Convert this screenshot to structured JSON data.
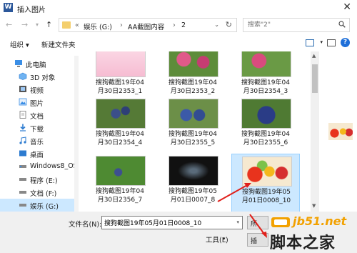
{
  "window": {
    "title": "插入图片",
    "app_icon_letter": "W"
  },
  "address": {
    "crumb_prefix": "«",
    "crumbs": [
      "娱乐 (G:)",
      "AA截图内容",
      "2"
    ],
    "separator": "›"
  },
  "search": {
    "placeholder": "搜索\"2\""
  },
  "toolbar": {
    "organize": "组织 ▾",
    "new_folder": "新建文件夹"
  },
  "sidebar": {
    "items": [
      {
        "label": "此电脑",
        "icon": "computer-icon"
      },
      {
        "label": "3D 对象",
        "icon": "cube-icon"
      },
      {
        "label": "视频",
        "icon": "video-icon"
      },
      {
        "label": "图片",
        "icon": "picture-icon"
      },
      {
        "label": "文档",
        "icon": "document-icon"
      },
      {
        "label": "下载",
        "icon": "download-icon"
      },
      {
        "label": "音乐",
        "icon": "music-icon"
      },
      {
        "label": "桌面",
        "icon": "desktop-icon"
      },
      {
        "label": "Windows8_OS",
        "icon": "drive-icon"
      },
      {
        "label": "程序 (E:)",
        "icon": "drive-icon"
      },
      {
        "label": "文档 (F:)",
        "icon": "drive-icon"
      },
      {
        "label": "娱乐 (G:)",
        "icon": "drive-icon"
      }
    ]
  },
  "files": [
    {
      "line1": "搜狗截图19年04",
      "line2": "月30日2353_1"
    },
    {
      "line1": "搜狗截图19年04",
      "line2": "月30日2353_2"
    },
    {
      "line1": "搜狗截图19年04",
      "line2": "月30日2354_3"
    },
    {
      "line1": "搜狗截图19年04",
      "line2": "月30日2354_4"
    },
    {
      "line1": "搜狗截图19年04",
      "line2": "月30日2355_5"
    },
    {
      "line1": "搜狗截图19年04",
      "line2": "月30日2355_6"
    },
    {
      "line1": "搜狗截图19年04",
      "line2": "月30日2356_7"
    },
    {
      "line1": "搜狗截图19年05",
      "line2": "月01日0007_8"
    },
    {
      "line1": "搜狗截图19年05",
      "line2": "月01日0008_10"
    }
  ],
  "bottom": {
    "filename_label": "文件名(N):",
    "filename_value": "搜狗截图19年05月01日0008_10",
    "filetype_value": "所",
    "tools_label": "工具(L)",
    "insert_label": "插"
  },
  "watermark": {
    "site": "jb51.net",
    "chinese": "脚本之家"
  },
  "colors": {
    "selection": "#cce8ff",
    "accent": "#1e6fd9",
    "arrow": "#e0201b"
  }
}
